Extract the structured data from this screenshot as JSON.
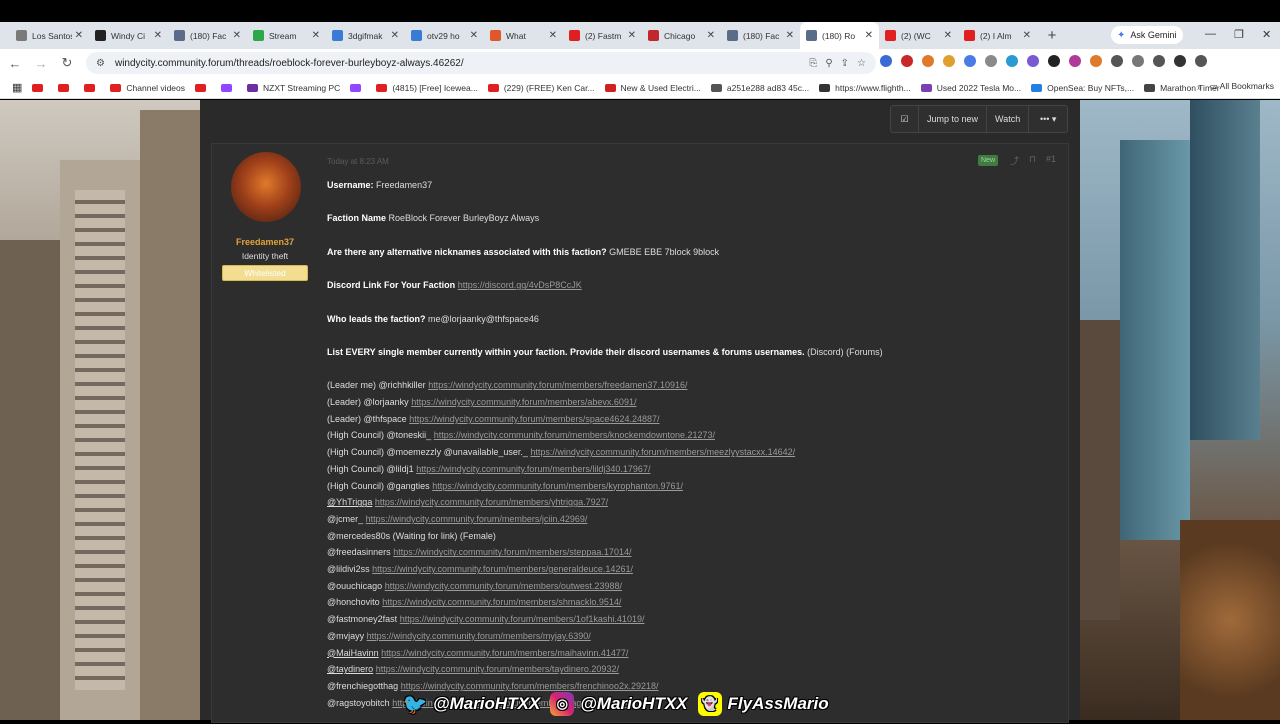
{
  "browser": {
    "tabs": [
      {
        "label": "Los Santos",
        "color": "#7a7a7a"
      },
      {
        "label": "Windy Ci",
        "color": "#222222"
      },
      {
        "label": "(180) Fac",
        "color": "#5b6b8a"
      },
      {
        "label": "Stream",
        "color": "#2aa84a"
      },
      {
        "label": "3dgifmak",
        "color": "#3a7bd5"
      },
      {
        "label": "otv29 ho",
        "color": "#3a7bd5"
      },
      {
        "label": "What",
        "color": "#e0572a"
      },
      {
        "label": "(2) Fastm",
        "color": "#e02020"
      },
      {
        "label": "Chicago",
        "color": "#c0282d"
      },
      {
        "label": "(180) Fac",
        "color": "#5b6b8a"
      },
      {
        "label": "(180) Ro",
        "color": "#5b6b8a",
        "active": true
      },
      {
        "label": "(2) (WC",
        "color": "#e02020"
      },
      {
        "label": "(2) I Alm",
        "color": "#e02020"
      }
    ],
    "ask_gemini": "Ask Gemini",
    "url": "windycity.community.forum/threads/roeblock-forever-burleyboyz-always.46262/",
    "bookmarks": [
      {
        "label": "",
        "color": "#e02020"
      },
      {
        "label": "",
        "color": "#e02020"
      },
      {
        "label": "",
        "color": "#e02020"
      },
      {
        "label": "Channel videos",
        "color": "#e02020"
      },
      {
        "label": "",
        "color": "#e02020"
      },
      {
        "label": "",
        "color": "#9146ff"
      },
      {
        "label": "NZXT Streaming PC",
        "color": "#6b2fa0"
      },
      {
        "label": "",
        "color": "#9146ff"
      },
      {
        "label": "(4815) [Free] Icewea...",
        "color": "#e02020"
      },
      {
        "label": "(229) (FREE) Ken Car...",
        "color": "#e02020"
      },
      {
        "label": "New & Used Electri...",
        "color": "#d02020"
      },
      {
        "label": "a251e288 ad83 45c...",
        "color": "#555555"
      },
      {
        "label": "https://www.flighth...",
        "color": "#333333"
      },
      {
        "label": "Used 2022 Tesla Mo...",
        "color": "#7a3fb0"
      },
      {
        "label": "OpenSea: Buy NFTs,...",
        "color": "#2081e2"
      },
      {
        "label": "Marathon Timer",
        "color": "#444444"
      }
    ],
    "all_bookmarks": "All Bookmarks"
  },
  "thread": {
    "actions": {
      "jump": "Jump to new",
      "watch": "Watch",
      "more": "•••"
    },
    "post": {
      "username": "Freedamen37",
      "user_title": "Identity theft",
      "user_badge": "Whitelisted",
      "timestamp": "Today at 8:23 AM",
      "new_badge": "New",
      "post_number": "#1",
      "fields": [
        {
          "label": "Username:",
          "value": "Freedamen37"
        },
        {
          "label": "Faction Name",
          "value": "RoeBlock Forever BurleyBoyz Always"
        },
        {
          "label": "Are there any alternative nicknames associated with this faction?",
          "value": "GMEBE EBE 7block 9block"
        },
        {
          "label": "Discord Link For Your Faction",
          "value": "https://discord.gg/4vDsP8CcJK"
        },
        {
          "label": "Who leads the faction?",
          "value": "me@lorjaanky@thfspace46"
        },
        {
          "label": "List EVERY single member currently within your faction. Provide their discord usernames & forums usernames.",
          "value": "(Discord) (Forums)"
        }
      ],
      "members": [
        {
          "text": "(Leader me) @richhkiller",
          "link": "https://windycity.community.forum/members/freedamen37.10916/"
        },
        {
          "text": "(Leader) @lorjaanky",
          "link": "https://windycity.community.forum/members/abevx.6091/"
        },
        {
          "text": "(Leader) @thfspace",
          "link": "https://windycity.community.forum/members/space4624.24887/"
        },
        {
          "text": "(High Council) @toneskii_",
          "link": "https://windycity.community.forum/members/knockemdowntone.21273/"
        },
        {
          "text": "(High Council) @moemezzly @unavailable_user._",
          "link": "https://windycity.community.forum/members/meezlyystacxx.14642/"
        },
        {
          "text": "(High Council) @lildj1",
          "link": "https://windycity.community.forum/members/lildj340.17967/"
        },
        {
          "text": "(High Council) @gangties",
          "link": "https://windycity.community.forum/members/kyrophanton.9761/"
        },
        {
          "text": "@YhTrigga",
          "link": "https://windycity.community.forum/members/yhtrigga.7927/",
          "underline": true
        },
        {
          "text": "@jcmer_",
          "link": "https://windycity.community.forum/members/jciin.42969/"
        },
        {
          "text": "@mercedes80s (Waiting for link) (Female)",
          "link": ""
        },
        {
          "text": "@freedasinners",
          "link": "https://windycity.community.forum/members/steppaa.17014/"
        },
        {
          "text": "@lildivi2ss",
          "link": "https://windycity.community.forum/members/generaldeuce.14261/"
        },
        {
          "text": "@ouuchicago",
          "link": "https://windycity.community.forum/members/outwest.23988/"
        },
        {
          "text": "@honchovito",
          "link": "https://windycity.community.forum/members/shmacklo.9514/"
        },
        {
          "text": "@fastmoney2fast",
          "link": "https://windycity.community.forum/members/1of1kashi.41019/"
        },
        {
          "text": "@mvjayy",
          "link": "https://windycity.community.forum/members/myjay.6390/"
        },
        {
          "text": "@MaiHavinn",
          "link": "https://windycity.community.forum/members/maihavinn.41477/",
          "underline": true
        },
        {
          "text": "@taydinero",
          "link": "https://windycity.community.forum/members/taydinero.20932/",
          "underline": true
        },
        {
          "text": "@frenchiegotthag",
          "link": "https://windycity.community.forum/members/frenchinoo2x.29218/"
        },
        {
          "text": "@ragstoyobitch",
          "link": "https://windycity.community.forum/members/ragstoyo.22314/"
        }
      ]
    }
  },
  "overlay": {
    "twitter": "@MarioHTXX",
    "instagram": "@MarioHTXX",
    "snapchat": "FlyAssMario"
  }
}
